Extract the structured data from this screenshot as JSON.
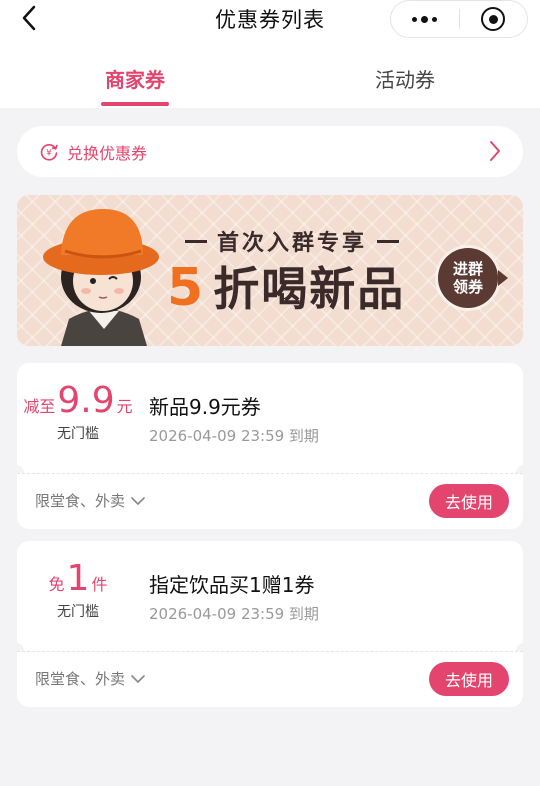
{
  "header": {
    "title": "优惠券列表",
    "back_icon": "back-chevron-icon",
    "menu_icon": "more-dots-icon",
    "close_icon": "record-target-icon"
  },
  "tabs": [
    {
      "label": "商家券",
      "active": true
    },
    {
      "label": "活动券",
      "active": false
    }
  ],
  "accent_color": "#e3456e",
  "redeem": {
    "label": "兑换优惠券",
    "icon": "coupon-exchange-icon",
    "chevron": "chevron-right-icon"
  },
  "banner": {
    "headline": "首次入群专享",
    "main_number": "5",
    "main_text": "折喝新品",
    "badge_line1": "进群",
    "badge_line2": "领券"
  },
  "coupons": [
    {
      "prefix": "减至",
      "value": "9.9",
      "suffix": "元",
      "threshold": "无门槛",
      "name": "新品9.9元券",
      "expiry": "2026-04-09 23:59 到期",
      "scope": "限堂食、外卖",
      "button": "去使用"
    },
    {
      "prefix": "免",
      "value": "1",
      "suffix": "件",
      "threshold": "无门槛",
      "name": "指定饮品买1赠1券",
      "expiry": "2026-04-09 23:59 到期",
      "scope": "限堂食、外卖",
      "button": "去使用"
    }
  ]
}
